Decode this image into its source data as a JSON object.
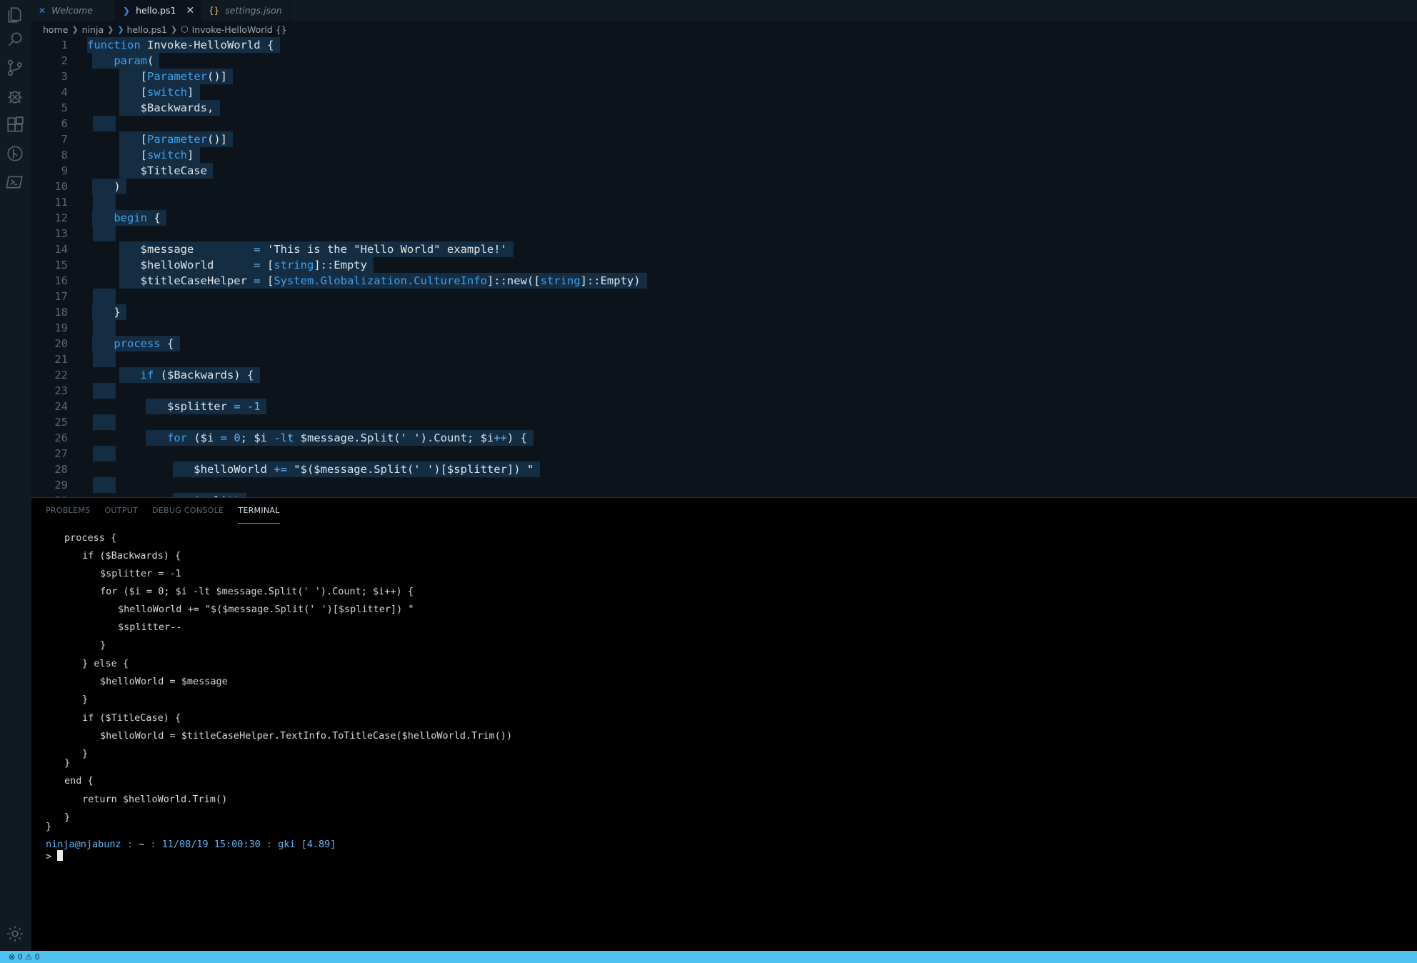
{
  "activity_bar": [
    "explorer-icon",
    "search-icon",
    "source-control-icon",
    "debug-icon",
    "extensions-icon",
    "git-graph-icon",
    "powershell-icon",
    "settings-gear-icon"
  ],
  "tabs": [
    {
      "label": "Welcome",
      "icon": "vscode-icon",
      "active": false
    },
    {
      "label": "hello.ps1",
      "icon": "powershell-file-icon",
      "active": true,
      "close": "✕"
    },
    {
      "label": "settings.json",
      "icon": "json-file-icon",
      "active": false,
      "glyph": "{}"
    }
  ],
  "breadcrumb": {
    "items": [
      "home",
      "ninja",
      "hello.ps1",
      "Invoke-HelloWorld {}"
    ]
  },
  "editor": {
    "lines": [
      "function Invoke-HelloWorld {",
      "    param(",
      "        [Parameter()]",
      "        [switch]",
      "        $Backwards,",
      "",
      "        [Parameter()]",
      "        [switch]",
      "        $TitleCase",
      "    )",
      "",
      "    begin {",
      "",
      "        $message         = 'This is the \"Hello World\" example!'",
      "        $helloWorld      = [string]::Empty",
      "        $titleCaseHelper = [System.Globalization.CultureInfo]::new([string]::Empty)",
      "",
      "    }",
      "",
      "    process {",
      "",
      "        if ($Backwards) {",
      "",
      "            $splitter = -1",
      "",
      "            for ($i = 0; $i -lt $message.Split(' ').Count; $i++) {",
      "",
      "                $helloWorld += \"$($message.Split(' ')[$splitter]) \"",
      "",
      "                $splitt"
    ]
  },
  "panel": {
    "tabs": [
      "PROBLEMS",
      "OUTPUT",
      "DEBUG CONSOLE",
      "TERMINAL"
    ],
    "active_tab": "TERMINAL"
  },
  "terminal": {
    "lines": [
      "    process {",
      "        if ($Backwards) {",
      "            $splitter = -1",
      "            for ($i = 0; $i -lt $message.Split(' ').Count; $i++) {",
      "                $helloWorld += \"$($message.Split(' ')[$splitter]) \"",
      "                $splitter--",
      "            }",
      "        } else {",
      "            $helloWorld = $message",
      "        }",
      "        if ($TitleCase) {",
      "            $helloWorld = $titleCaseHelper.TextInfo.ToTitleCase($helloWorld.Trim())",
      "        }",
      "    }",
      "    end {",
      "        return $helloWorld.Trim()",
      "    }",
      "}"
    ],
    "prompt": {
      "user": "ninja@njabunz",
      "sep1": " : ",
      "dir": "~",
      "sep2": " : ",
      "datetime": "11/08/19 15:00:30",
      "sep3": " : ",
      "command": "gki [4.89]",
      "input_prefix": "> "
    }
  },
  "statusbar": {
    "errors": "0",
    "warnings": "0"
  }
}
